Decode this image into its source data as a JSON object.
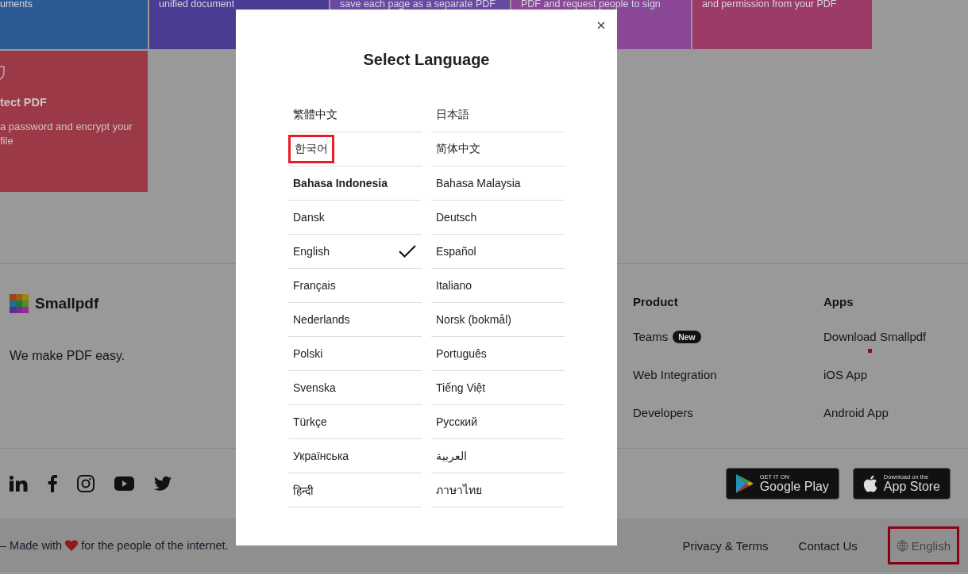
{
  "tiles": [
    {
      "text": "uments",
      "color": "#2b5b92"
    },
    {
      "text": "unified document",
      "color": "#4a3b93"
    },
    {
      "text": "save each page as a separate PDF",
      "color": "#6a4aa0"
    },
    {
      "text": "PDF and request people to sign",
      "color": "#8a4896"
    },
    {
      "text": "and permission from your PDF",
      "color": "#9c3a68"
    }
  ],
  "protect_tile": {
    "title": "tect PDF",
    "lines": [
      "a password and encrypt your",
      "file"
    ],
    "color": "#9c3947"
  },
  "footer": {
    "brand": "Smallpdf",
    "tagline": "We make PDF easy.",
    "columns": [
      {
        "heading": "Product",
        "links": [
          {
            "label": "Teams",
            "badge": "New",
            "marked": false
          },
          {
            "label": "Web Integration",
            "marked": false
          },
          {
            "label": "Developers",
            "marked": false
          }
        ]
      },
      {
        "heading": "Apps",
        "links": [
          {
            "label": "Download Smallpdf",
            "marked": true
          },
          {
            "label": "iOS App",
            "marked": false
          },
          {
            "label": "Android App",
            "marked": false
          }
        ]
      }
    ],
    "store_badges": [
      {
        "kind": "google",
        "small": "GET IT ON",
        "big": "Google Play"
      },
      {
        "kind": "apple",
        "small": "Download on the",
        "big": "App Store"
      }
    ],
    "made_with": {
      "before": "– Made with",
      "after": "for the people of the internet."
    },
    "links": [
      "Privacy & Terms",
      "Contact Us"
    ],
    "language_button": {
      "label": "English",
      "highlighted": true
    }
  },
  "modal": {
    "title": "Select Language",
    "languages": [
      {
        "label": "繁體中文",
        "selected": false,
        "hovered": false,
        "highlighted": false
      },
      {
        "label": "日本語",
        "selected": false,
        "hovered": false,
        "highlighted": false
      },
      {
        "label": "한국어",
        "selected": false,
        "hovered": false,
        "highlighted": true
      },
      {
        "label": "简体中文",
        "selected": false,
        "hovered": false,
        "highlighted": false
      },
      {
        "label": "Bahasa Indonesia",
        "selected": false,
        "hovered": true,
        "highlighted": false
      },
      {
        "label": "Bahasa Malaysia",
        "selected": false,
        "hovered": false,
        "highlighted": false
      },
      {
        "label": "Dansk",
        "selected": false,
        "hovered": false,
        "highlighted": false
      },
      {
        "label": "Deutsch",
        "selected": false,
        "hovered": false,
        "highlighted": false
      },
      {
        "label": "English",
        "selected": true,
        "hovered": false,
        "highlighted": false
      },
      {
        "label": "Español",
        "selected": false,
        "hovered": false,
        "highlighted": false
      },
      {
        "label": "Français",
        "selected": false,
        "hovered": false,
        "highlighted": false
      },
      {
        "label": "Italiano",
        "selected": false,
        "hovered": false,
        "highlighted": false
      },
      {
        "label": "Nederlands",
        "selected": false,
        "hovered": false,
        "highlighted": false
      },
      {
        "label": "Norsk (bokmål)",
        "selected": false,
        "hovered": false,
        "highlighted": false
      },
      {
        "label": "Polski",
        "selected": false,
        "hovered": false,
        "highlighted": false
      },
      {
        "label": "Português",
        "selected": false,
        "hovered": false,
        "highlighted": false
      },
      {
        "label": "Svenska",
        "selected": false,
        "hovered": false,
        "highlighted": false
      },
      {
        "label": "Tiếng Việt",
        "selected": false,
        "hovered": false,
        "highlighted": false
      },
      {
        "label": "Türkçe",
        "selected": false,
        "hovered": false,
        "highlighted": false
      },
      {
        "label": "Русский",
        "selected": false,
        "hovered": false,
        "highlighted": false
      },
      {
        "label": "Українська",
        "selected": false,
        "hovered": false,
        "highlighted": false
      },
      {
        "label": "العربية",
        "selected": false,
        "hovered": false,
        "highlighted": false
      },
      {
        "label": "हिन्दी",
        "selected": false,
        "hovered": false,
        "highlighted": false
      },
      {
        "label": "ภาษาไทย",
        "selected": false,
        "hovered": false,
        "highlighted": false
      }
    ]
  }
}
